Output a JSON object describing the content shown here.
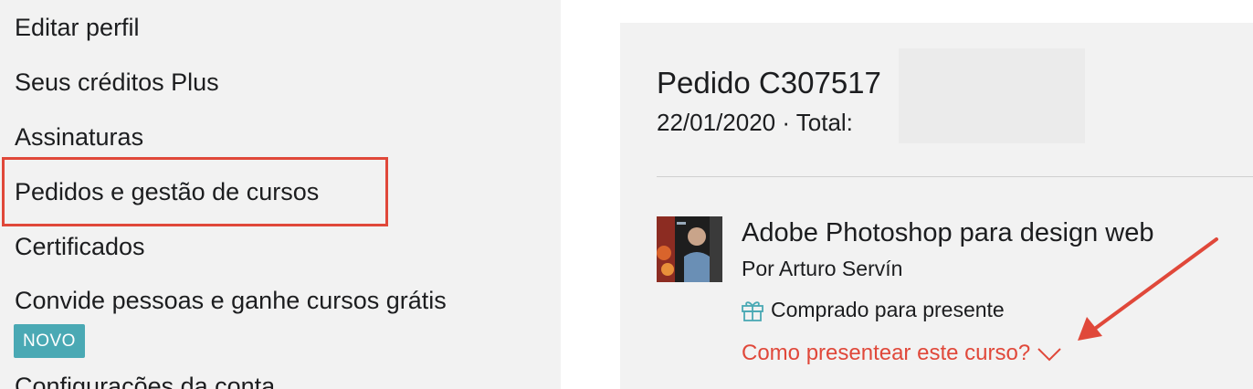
{
  "sidebar": {
    "items": [
      {
        "label": "Editar perfil"
      },
      {
        "label": "Seus créditos Plus"
      },
      {
        "label": "Assinaturas"
      },
      {
        "label": "Pedidos e gestão de cursos"
      },
      {
        "label": "Certificados"
      },
      {
        "label": "Convide pessoas e ganhe cursos grátis"
      },
      {
        "label": "Configurações da conta"
      }
    ],
    "badge": "NOVO"
  },
  "order": {
    "title": "Pedido C307517",
    "meta": "22/01/2020 · Total:",
    "course": {
      "title": "Adobe Photoshop para design web",
      "author": "Por Arturo Servín",
      "gift_status": "Comprado para presente",
      "gift_link": "Como presentear este curso?"
    }
  },
  "colors": {
    "accent": "#e0483a",
    "badge": "#4aa9b4",
    "panel_bg": "#f2f2f2"
  },
  "icons": {
    "gift": "gift-icon",
    "chevron": "chevron-down-icon"
  }
}
